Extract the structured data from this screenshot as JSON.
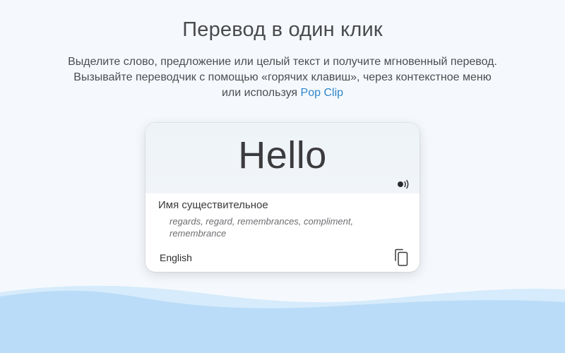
{
  "header": {
    "title": "Перевод в один клик",
    "subtitle_line1": "Выделите слово, предложение или целый текст и получите мгновенный перевод.",
    "subtitle_line2": "Вызывайте переводчик с помощью «горячих клавиш», через контекстное меню",
    "subtitle_line3_prefix": "или используя",
    "subtitle_link": "Pop Clip"
  },
  "card": {
    "word": "Hello",
    "part_of_speech": "Имя существительное",
    "synonyms_line1": "regards, regard, remembrances, compliment,",
    "synonyms_line2": "remembrance",
    "language": "English",
    "speaker_icon": "speaker-icon",
    "copy_icon": "copy-icon"
  },
  "colors": {
    "background": "#f5f9fd",
    "link": "#2e86c8",
    "wave_light": "#d6ebfb",
    "wave_dark": "#b8dcf8"
  }
}
